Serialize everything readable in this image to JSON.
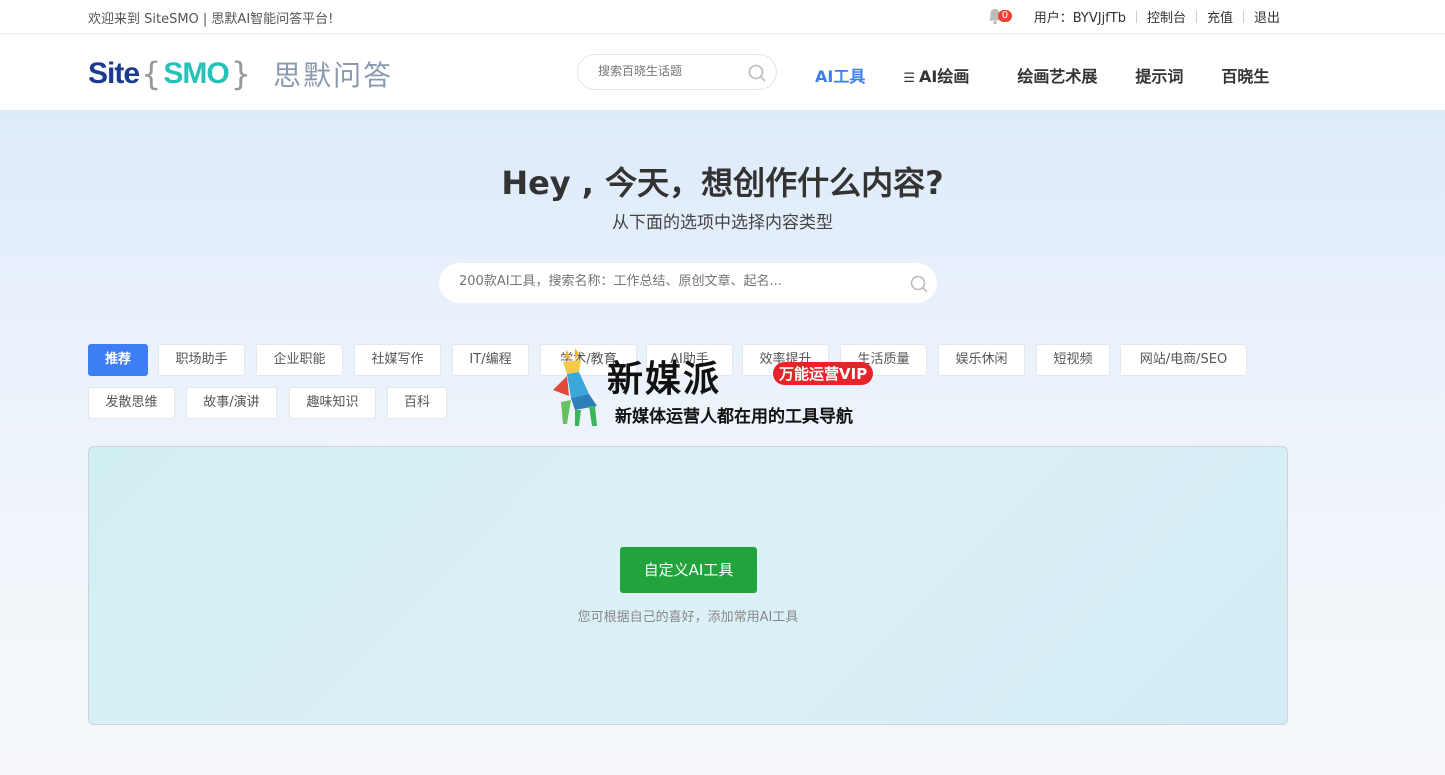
{
  "topbar": {
    "welcome": "欢迎来到 SiteSMO | 思默AI智能问答平台!",
    "notifications": "0",
    "user": "用户：BYVJjfTb",
    "console": "控制台",
    "recharge": "充值",
    "logout": "退出"
  },
  "header": {
    "logo_site": "Site",
    "logo_smo": "SMO",
    "logo_cn": "思默问答",
    "search_placeholder": "搜索百晓生话题",
    "nav": [
      "AI工具",
      "AI绘画",
      "绘画艺术展",
      "提示词",
      "百晓生"
    ]
  },
  "hero": {
    "title": "Hey , 今天，想创作什么内容?",
    "subtitle": "从下面的选项中选择内容类型",
    "search_placeholder": "200款AI工具，搜索名称：工作总结、原创文章、起名..."
  },
  "categories": [
    "推荐",
    "职场助手",
    "企业职能",
    "社媒写作",
    "IT/编程",
    "学术/教育",
    "AI助手",
    "效率提升",
    "生活质量",
    "娱乐休闲",
    "短视频",
    "网站/电商/SEO",
    "发散思维",
    "故事/演讲",
    "趣味知识",
    "百科"
  ],
  "watermark": {
    "brand": "新媒派",
    "badge": "万能运营VIP",
    "slogan": "新媒体运营人都在用的工具导航"
  },
  "panel": {
    "button": "自定义AI工具",
    "hint": "您可根据自己的喜好，添加常用AI工具"
  },
  "colors": {
    "accent": "#3d7ef5",
    "button_green": "#21a43c",
    "badge_red": "#f04134"
  }
}
